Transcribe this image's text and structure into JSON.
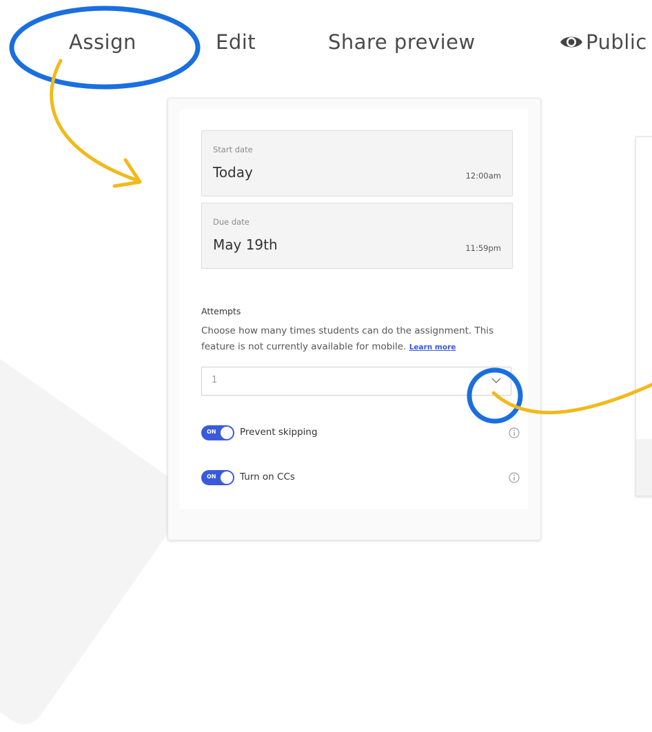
{
  "nav": {
    "assign": "Assign",
    "edit": "Edit",
    "share_preview": "Share preview",
    "public": "Public",
    "public_icon": "eye-icon"
  },
  "start_date": {
    "label": "Start date",
    "value": "Today",
    "time": "12:00am"
  },
  "due_date": {
    "label": "Due date",
    "value": "May 19th",
    "time": "11:59pm"
  },
  "attempts": {
    "title": "Attempts",
    "description": "Choose how many times students can do the assignment. This feature is not currently available for mobile.",
    "learn_more": "Learn more",
    "selected_value": "1"
  },
  "toggles": [
    {
      "state": "ON",
      "label": "Prevent skipping",
      "icon": "info-icon"
    },
    {
      "state": "ON",
      "label": "Turn on CCs",
      "icon": "info-icon"
    }
  ],
  "colors": {
    "annotation_blue": "#1a6fe0",
    "annotation_arrow": "#f2b91a",
    "toggle_on": "#3a5bd9",
    "link": "#3b57e4"
  }
}
